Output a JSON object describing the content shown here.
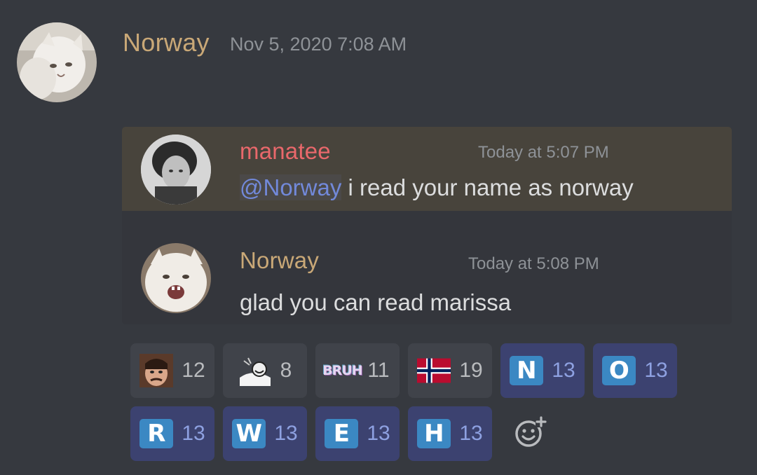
{
  "header": {
    "author": "Norway",
    "timestamp": "Nov 5, 2020 7:08 AM",
    "author_color": "#c9a877"
  },
  "messages": [
    {
      "author": "manatee",
      "author_color": "#e9686b",
      "timestamp": "Today at 5:07 PM",
      "mention": "@Norway",
      "text": " i read your name as norway",
      "highlighted": true
    },
    {
      "author": "Norway",
      "author_color": "#c9a877",
      "timestamp": "Today at 5:08 PM",
      "text": "glad you can read marissa",
      "highlighted": false
    }
  ],
  "reactions": [
    {
      "emoji": "ringo-face-emoji",
      "count": "12",
      "active": false
    },
    {
      "emoji": "trollface-meme-emoji",
      "count": "8",
      "active": false
    },
    {
      "emoji": "bruh-text-emoji",
      "label": "BRUH",
      "count": "11",
      "active": false
    },
    {
      "emoji": "norway-flag-emoji",
      "count": "19",
      "active": false
    },
    {
      "emoji": "regional-indicator-n",
      "label": "N",
      "count": "13",
      "active": true
    },
    {
      "emoji": "regional-indicator-o",
      "label": "O",
      "count": "13",
      "active": true
    },
    {
      "emoji": "regional-indicator-r",
      "label": "R",
      "count": "13",
      "active": true
    },
    {
      "emoji": "regional-indicator-w",
      "label": "W",
      "count": "13",
      "active": true
    },
    {
      "emoji": "regional-indicator-e",
      "label": "E",
      "count": "13",
      "active": true
    },
    {
      "emoji": "regional-indicator-h",
      "label": "H",
      "count": "13",
      "active": true
    }
  ],
  "add_reaction_icon": "add-reaction-smiley-icon",
  "colors": {
    "background": "#36393f",
    "highlight": "#48443c",
    "mention": "#7289da",
    "reaction_active": "#3c4270",
    "letter_emoji": "#3b88c3"
  }
}
